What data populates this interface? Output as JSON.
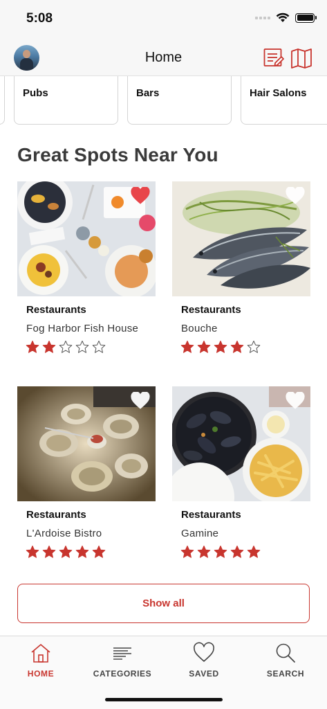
{
  "status_bar": {
    "time": "5:08"
  },
  "nav": {
    "title": "Home",
    "icons": [
      "avatar",
      "write-review-icon",
      "map-icon"
    ]
  },
  "categories": [
    {
      "label": "Pubs"
    },
    {
      "label": "Bars"
    },
    {
      "label": "Hair Salons"
    }
  ],
  "section_title": "Great Spots Near You",
  "spots": [
    {
      "category": "Restaurants",
      "name": "Fog Harbor Fish House",
      "rating": 2,
      "saved": true
    },
    {
      "category": "Restaurants",
      "name": "Bouche",
      "rating": 4,
      "saved": false
    },
    {
      "category": "Restaurants",
      "name": "L'Ardoise Bistro",
      "rating": 5,
      "saved": false
    },
    {
      "category": "Restaurants",
      "name": "Gamine",
      "rating": 5,
      "saved": false
    }
  ],
  "show_all_label": "Show all",
  "tabs": [
    {
      "label": "HOME",
      "icon": "home-icon",
      "active": true
    },
    {
      "label": "CATEGORIES",
      "icon": "categories-icon",
      "active": false
    },
    {
      "label": "SAVED",
      "icon": "heart-icon",
      "active": false
    },
    {
      "label": "SEARCH",
      "icon": "search-icon",
      "active": false
    }
  ],
  "colors": {
    "accent": "#c8352e",
    "star": "#c8352e",
    "heart_saved": "#e8454a",
    "heart_unsaved": "#ffffff"
  }
}
